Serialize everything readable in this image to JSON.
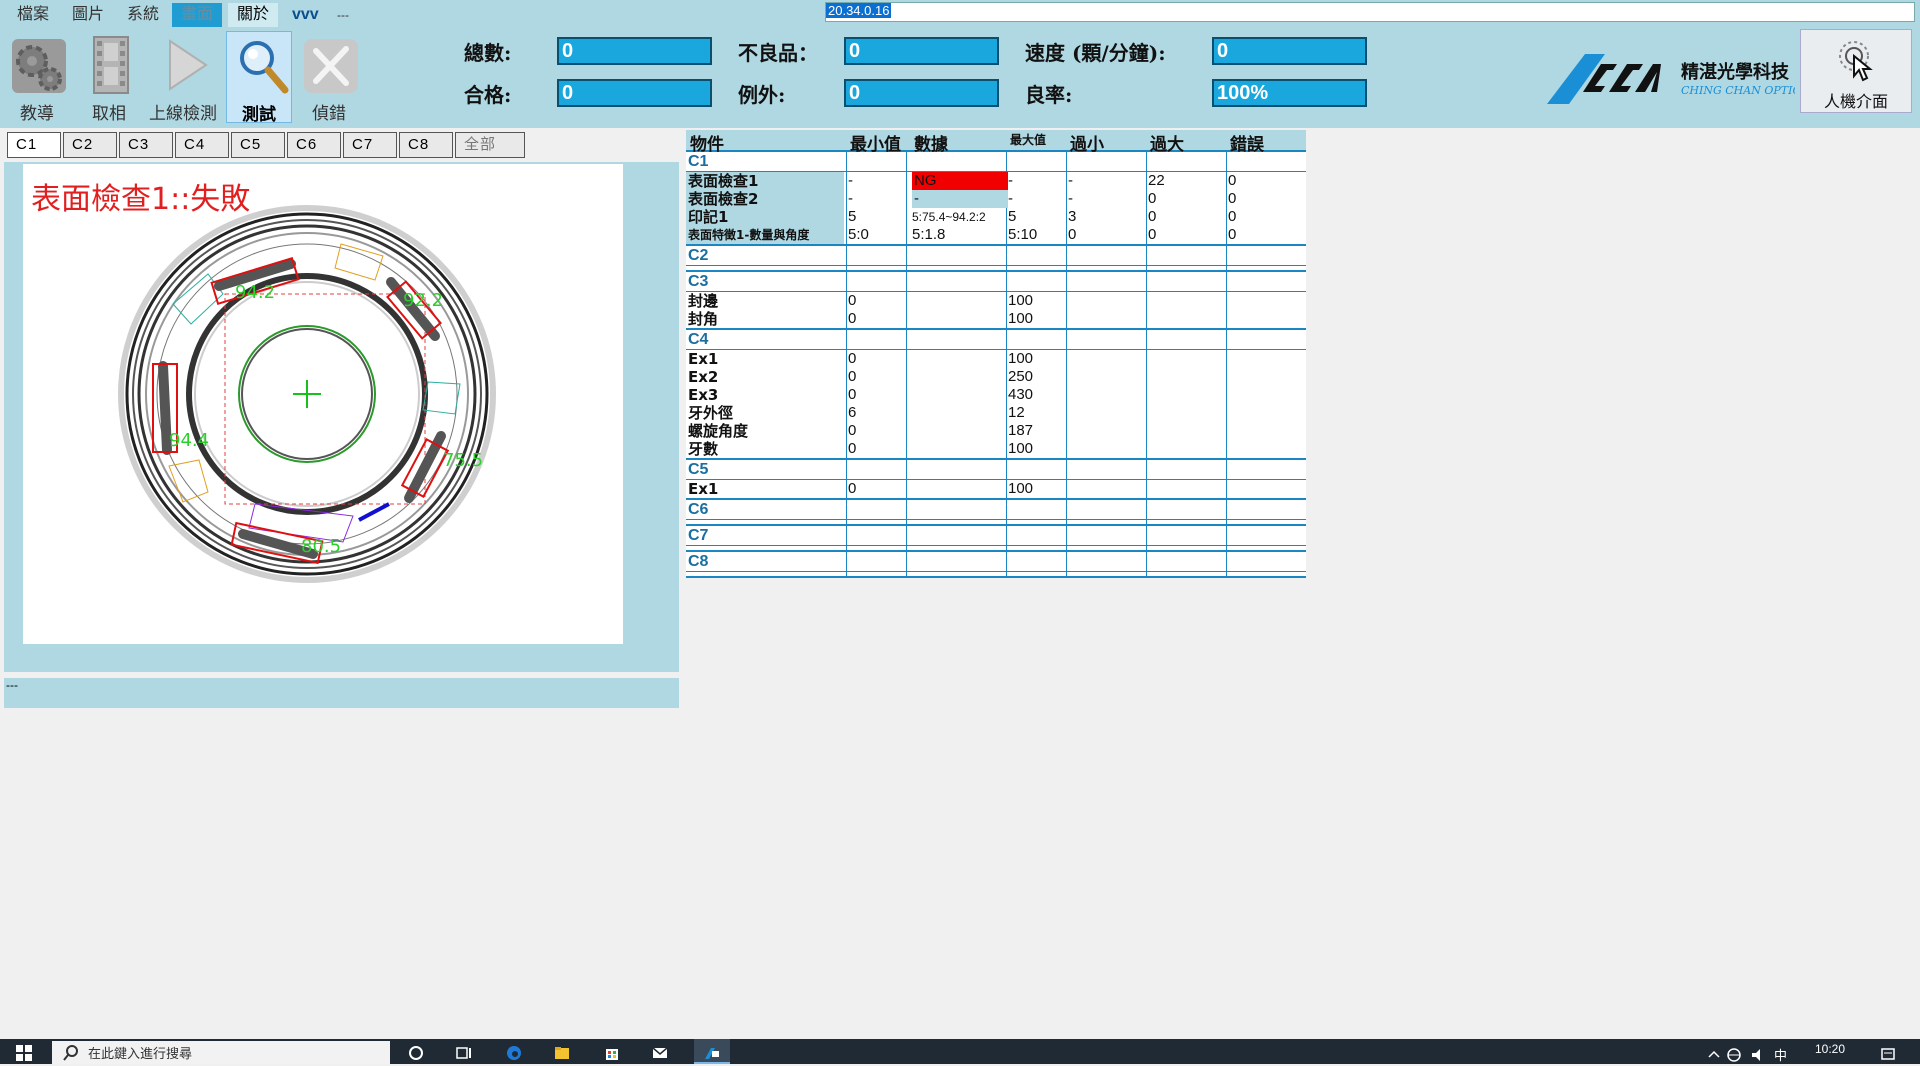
{
  "menu": {
    "items": [
      "檔案",
      "圖片",
      "系統",
      "畫面",
      "關於",
      "vvv",
      "---"
    ],
    "version": "20.34.0.16"
  },
  "toolbar": {
    "buttons": [
      {
        "label": "教導",
        "icon": "gears-icon"
      },
      {
        "label": "取相",
        "icon": "film-icon"
      },
      {
        "label": "上線檢測",
        "icon": "play-icon"
      },
      {
        "label": "測試",
        "icon": "magnifier-icon"
      },
      {
        "label": "偵錯",
        "icon": "tools-icon"
      }
    ]
  },
  "stats": {
    "total_label": "總數:",
    "total_value": "0",
    "defect_label": "不良品：",
    "defect_value": "0",
    "speed_label": "速度 (顆/分鐘):",
    "speed_value": "0",
    "pass_label": "合格:",
    "pass_value": "0",
    "exception_label": "例外:",
    "exception_value": "0",
    "yield_label": "良率:",
    "yield_value": "100%"
  },
  "logo": {
    "name": "精湛光學科技",
    "sub": "CHING CHAN OPTICAL"
  },
  "hmi": {
    "label": "人機介面"
  },
  "camera_tabs": [
    "C1",
    "C2",
    "C3",
    "C4",
    "C5",
    "C6",
    "C7",
    "C8",
    "全部"
  ],
  "image": {
    "result_text": "表面檢查1::失敗",
    "marks": [
      "94.2",
      "92.2",
      "94.4",
      "75.5",
      "80.5"
    ]
  },
  "status_text": "---",
  "table": {
    "headers": [
      "物件",
      "最小值",
      "數據",
      "最大值",
      "過小",
      "過大",
      "錯誤"
    ],
    "groups": [
      {
        "title": "C1",
        "rows": [
          {
            "name": "表面檢查1",
            "min": "-",
            "data": "NG",
            "max": "-",
            "under": "-",
            "over": "22",
            "error": "0"
          },
          {
            "name": "表面檢查2",
            "min": "-",
            "data": "-",
            "max": "-",
            "under": "-",
            "over": "0",
            "error": "0"
          },
          {
            "name": "印記1",
            "min": "5",
            "data": "5:75.4~94.2:2",
            "max": "5",
            "under": "3",
            "over": "0",
            "error": "0"
          },
          {
            "name": "表面特徵1-數量與角度",
            "min": "5:0",
            "data": "5:1.8",
            "max": "5:10",
            "under": "0",
            "over": "0",
            "error": "0"
          }
        ]
      },
      {
        "title": "C2",
        "rows": []
      },
      {
        "title": "C3",
        "rows": [
          {
            "name": "封邊",
            "min": "0",
            "data": "",
            "max": "100",
            "under": "",
            "over": "",
            "error": ""
          },
          {
            "name": "封角",
            "min": "0",
            "data": "",
            "max": "100",
            "under": "",
            "over": "",
            "error": ""
          }
        ]
      },
      {
        "title": "C4",
        "rows": [
          {
            "name": "Ex1",
            "min": "0",
            "data": "",
            "max": "100",
            "under": "",
            "over": "",
            "error": ""
          },
          {
            "name": "Ex2",
            "min": "0",
            "data": "",
            "max": "250",
            "under": "",
            "over": "",
            "error": ""
          },
          {
            "name": "Ex3",
            "min": "0",
            "data": "",
            "max": "430",
            "under": "",
            "over": "",
            "error": ""
          },
          {
            "name": "牙外徑",
            "min": "6",
            "data": "",
            "max": "12",
            "under": "",
            "over": "",
            "error": ""
          },
          {
            "name": "螺旋角度",
            "min": "0",
            "data": "",
            "max": "187",
            "under": "",
            "over": "",
            "error": ""
          },
          {
            "name": "牙數",
            "min": "0",
            "data": "",
            "max": "100",
            "under": "",
            "over": "",
            "error": ""
          }
        ]
      },
      {
        "title": "C5",
        "rows": [
          {
            "name": "Ex1",
            "min": "0",
            "data": "",
            "max": "100",
            "under": "",
            "over": "",
            "error": ""
          }
        ]
      },
      {
        "title": "C6",
        "rows": []
      },
      {
        "title": "C7",
        "rows": []
      },
      {
        "title": "C8",
        "rows": []
      }
    ]
  },
  "taskbar": {
    "search_placeholder": "在此鍵入進行搜尋",
    "time": "10:20",
    "ime": "中"
  },
  "colors": {
    "panel_bg": "#b0d8e2",
    "stat_box": "#1aa7dd",
    "ng_red": "#f00000",
    "grid_line": "#1a86c2",
    "fail_text": "#e02020"
  }
}
